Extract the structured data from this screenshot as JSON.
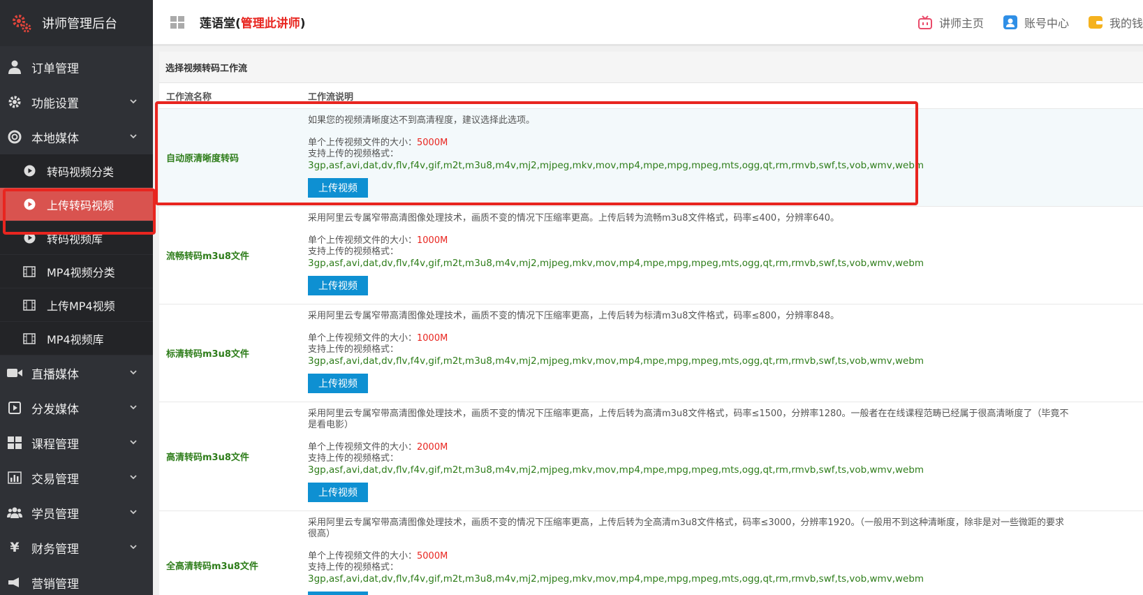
{
  "sidebar": {
    "brand": "讲师管理后台",
    "items": [
      {
        "label": "订单管理",
        "icon": "user-icon"
      },
      {
        "label": "功能设置",
        "icon": "gear-icon",
        "chevron": true
      },
      {
        "label": "本地媒体",
        "icon": "lifebuoy-icon",
        "chevron": true
      }
    ],
    "local_media_sub": [
      {
        "label": "转码视频分类",
        "icon": "play-circle-icon"
      },
      {
        "label": "上传转码视频",
        "icon": "play-circle-icon",
        "active": true
      },
      {
        "label": "转码视频库",
        "icon": "play-circle-icon"
      },
      {
        "label": "MP4视频分类",
        "icon": "film-icon"
      },
      {
        "label": "上传MP4视频",
        "icon": "film-icon"
      },
      {
        "label": "MP4视频库",
        "icon": "film-icon"
      }
    ],
    "items_after": [
      {
        "label": "直播媒体",
        "icon": "video-camera-icon"
      },
      {
        "label": "分发媒体",
        "icon": "play-square-icon"
      },
      {
        "label": "课程管理",
        "icon": "grid-icon"
      },
      {
        "label": "交易管理",
        "icon": "bar-chart-icon"
      },
      {
        "label": "学员管理",
        "icon": "users-icon"
      },
      {
        "label": "财务管理",
        "icon": "yen-icon"
      },
      {
        "label": "营销管理",
        "icon": "megaphone-icon"
      }
    ]
  },
  "header": {
    "site_name": "莲语堂",
    "paren_open": "(",
    "manage_link": "管理此讲师",
    "paren_close": ")",
    "links": [
      {
        "label": "讲师主页",
        "icon": "tv-icon"
      },
      {
        "label": "账号中心",
        "icon": "account-icon"
      },
      {
        "label": "我的钱",
        "icon": "wallet-icon"
      }
    ]
  },
  "panel": {
    "title": "选择视频转码工作流",
    "col_name": "工作流名称",
    "col_desc": "工作流说明",
    "size_prefix": "单个上传视频文件的大小：",
    "formats_label": "支持上传的视频格式：",
    "formats": "3gp,asf,avi,dat,dv,flv,f4v,gif,m2t,m3u8,m4v,mj2,mjpeg,mkv,mov,mp4,mpe,mpg,mpeg,mts,ogg,qt,rm,rmvb,swf,ts,vob,wmv,webm",
    "upload_label": "上传视频",
    "workflows": [
      {
        "name": "自动原清晰度转码",
        "intro": "如果您的视频清晰度达不到高清程度，建议选择此选项。",
        "size": "5000M"
      },
      {
        "name": "流畅转码m3u8文件",
        "intro": "采用阿里云专属窄带高清图像处理技术，画质不变的情况下压缩率更高。上传后转为流畅m3u8文件格式，码率≤400，分辨率640。",
        "size": "1000M"
      },
      {
        "name": "标清转码m3u8文件",
        "intro": "采用阿里云专属窄带高清图像处理技术，画质不变的情况下压缩率更高，上传后转为标清m3u8文件格式，码率≤800，分辨率848。",
        "size": "1000M"
      },
      {
        "name": "高清转码m3u8文件",
        "intro": "采用阿里云专属窄带高清图像处理技术，画质不变的情况下压缩率更高，上传后转为高清m3u8文件格式，码率≤1500，分辨率1280。一般者在在线课程范畴已经属于很高清晰度了（毕竟不是看电影）",
        "size": "2000M"
      },
      {
        "name": "全高清转码m3u8文件",
        "intro": "采用阿里云专属窄带高清图像处理技术，画质不变的情况下压缩率更高，上传后转为全高清m3u8文件格式，码率≤3000，分辨率1920。（一般用不到这种清晰度，除非是对一些微距的要求很高）",
        "size": "5000M"
      }
    ]
  }
}
